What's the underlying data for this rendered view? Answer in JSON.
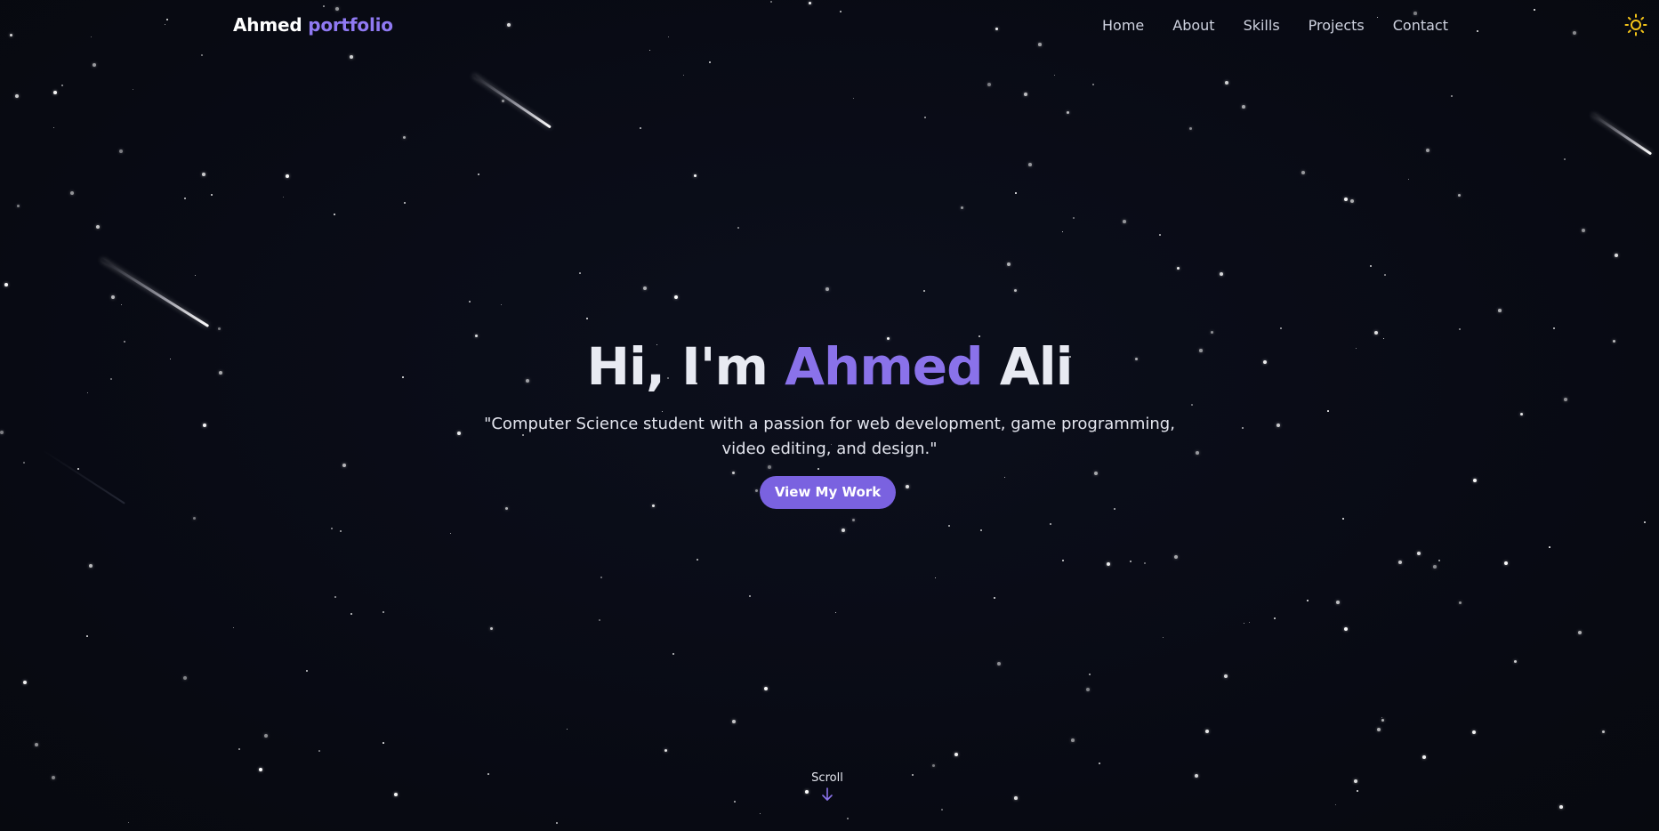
{
  "nav": {
    "brand_name": "Ahmed",
    "brand_accent": "portfolio",
    "items": [
      {
        "label": "Home"
      },
      {
        "label": "About"
      },
      {
        "label": "Skills"
      },
      {
        "label": "Projects"
      },
      {
        "label": "Contact"
      }
    ],
    "theme_icon": "sun-icon"
  },
  "hero": {
    "greeting": "Hi, I'm",
    "first_name": "Ahmed",
    "last_name": "Ali",
    "subtitle": "\"Computer Science student with a passion for web development, game programming, video editing, and design.\"",
    "cta_label": "View My Work"
  },
  "scroll": {
    "label": "Scroll",
    "icon": "arrow-down-icon"
  },
  "colors": {
    "background": "#090b14",
    "accent": "#8a72ea",
    "button": "#7a62e0",
    "sun": "#f5c518"
  }
}
